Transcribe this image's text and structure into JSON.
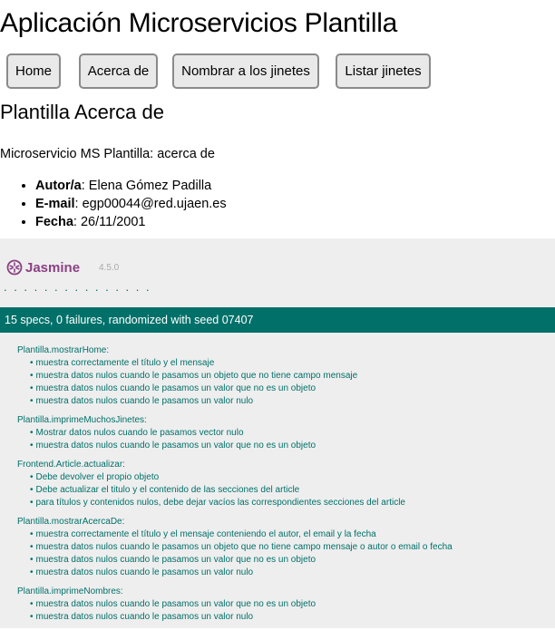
{
  "header": {
    "title": "Aplicación Microservicios Plantilla"
  },
  "nav": {
    "buttons": [
      {
        "label": "Home"
      },
      {
        "label": "Acerca de"
      },
      {
        "label": "Nombrar a los jinetes"
      },
      {
        "label": "Listar jinetes"
      }
    ]
  },
  "about": {
    "title": "Plantilla Acerca de",
    "intro": "Microservicio MS Plantilla: acerca de",
    "author_label": "Autor/a",
    "author_value": ": Elena Gómez Padilla",
    "email_label": "E-mail",
    "email_value": ": egp00044@red.ujaen.es",
    "date_label": "Fecha",
    "date_value": ": 26/11/2001"
  },
  "jasmine": {
    "logo_text": "Jasmine",
    "version": "4.5.0",
    "dots": "...............",
    "summary": "15 specs, 0 failures, randomized with seed 07407",
    "brand_color": "#007069",
    "logo_color": "#8a4182",
    "suites": [
      {
        "name": "Plantilla.mostrarHome:",
        "specs": [
          "muestra correctamente el título y el mensaje",
          "muestra datos nulos cuando le pasamos un objeto que no tiene campo mensaje",
          "muestra datos nulos cuando le pasamos un valor que no es un objeto",
          "muestra datos nulos cuando le pasamos un valor nulo"
        ]
      },
      {
        "name": "Plantilla.imprimeMuchosJinetes:",
        "specs": [
          "Mostrar datos nulos cuando le pasamos vector nulo",
          "muestra datos nulos cuando le pasamos un valor que no es un objeto"
        ]
      },
      {
        "name": "Frontend.Article.actualizar:",
        "specs": [
          "Debe devolver el propio objeto",
          "Debe actualizar el titulo y el contenido de las secciones del article",
          "para títulos y contenidos nulos, debe dejar vacíos las correspondientes secciones del article"
        ]
      },
      {
        "name": "Plantilla.mostrarAcercaDe:",
        "specs": [
          "muestra correctamente el título y el mensaje conteniendo el autor, el email y la fecha",
          "muestra datos nulos cuando le pasamos un objeto que no tiene campo mensaje o autor o email o fecha",
          "muestra datos nulos cuando le pasamos un valor que no es un objeto",
          "muestra datos nulos cuando le pasamos un valor nulo"
        ]
      },
      {
        "name": "Plantilla.imprimeNombres:",
        "specs": [
          "muestra datos nulos cuando le pasamos un valor que no es un objeto",
          "muestra datos nulos cuando le pasamos un valor nulo"
        ]
      }
    ]
  }
}
